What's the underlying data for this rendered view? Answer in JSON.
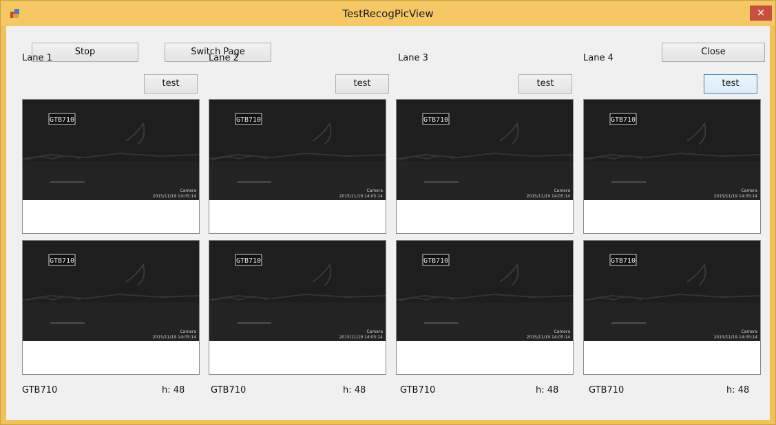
{
  "window": {
    "title": "TestRecogPicView",
    "close_glyph": "×",
    "app_icon": "app-icon"
  },
  "toolbar": {
    "stop_label": "Stop",
    "switch_page_label": "Switch Page",
    "close_label": "Close"
  },
  "lanes": [
    {
      "label": "Lane 1",
      "test_label": "test",
      "plate": "GTB710",
      "h": "h: 48"
    },
    {
      "label": "Lane 2",
      "test_label": "test",
      "plate": "GTB710",
      "h": "h: 48"
    },
    {
      "label": "Lane 3",
      "test_label": "test",
      "plate": "GTB710",
      "h": "h: 48"
    },
    {
      "label": "Lane 4",
      "test_label": "test",
      "plate": "GTB710",
      "h": "h: 48"
    }
  ],
  "feed": {
    "plate_overlay": "GTB710",
    "camera_label": "Camera",
    "timestamp": "2015/11/19 14:05:14"
  }
}
